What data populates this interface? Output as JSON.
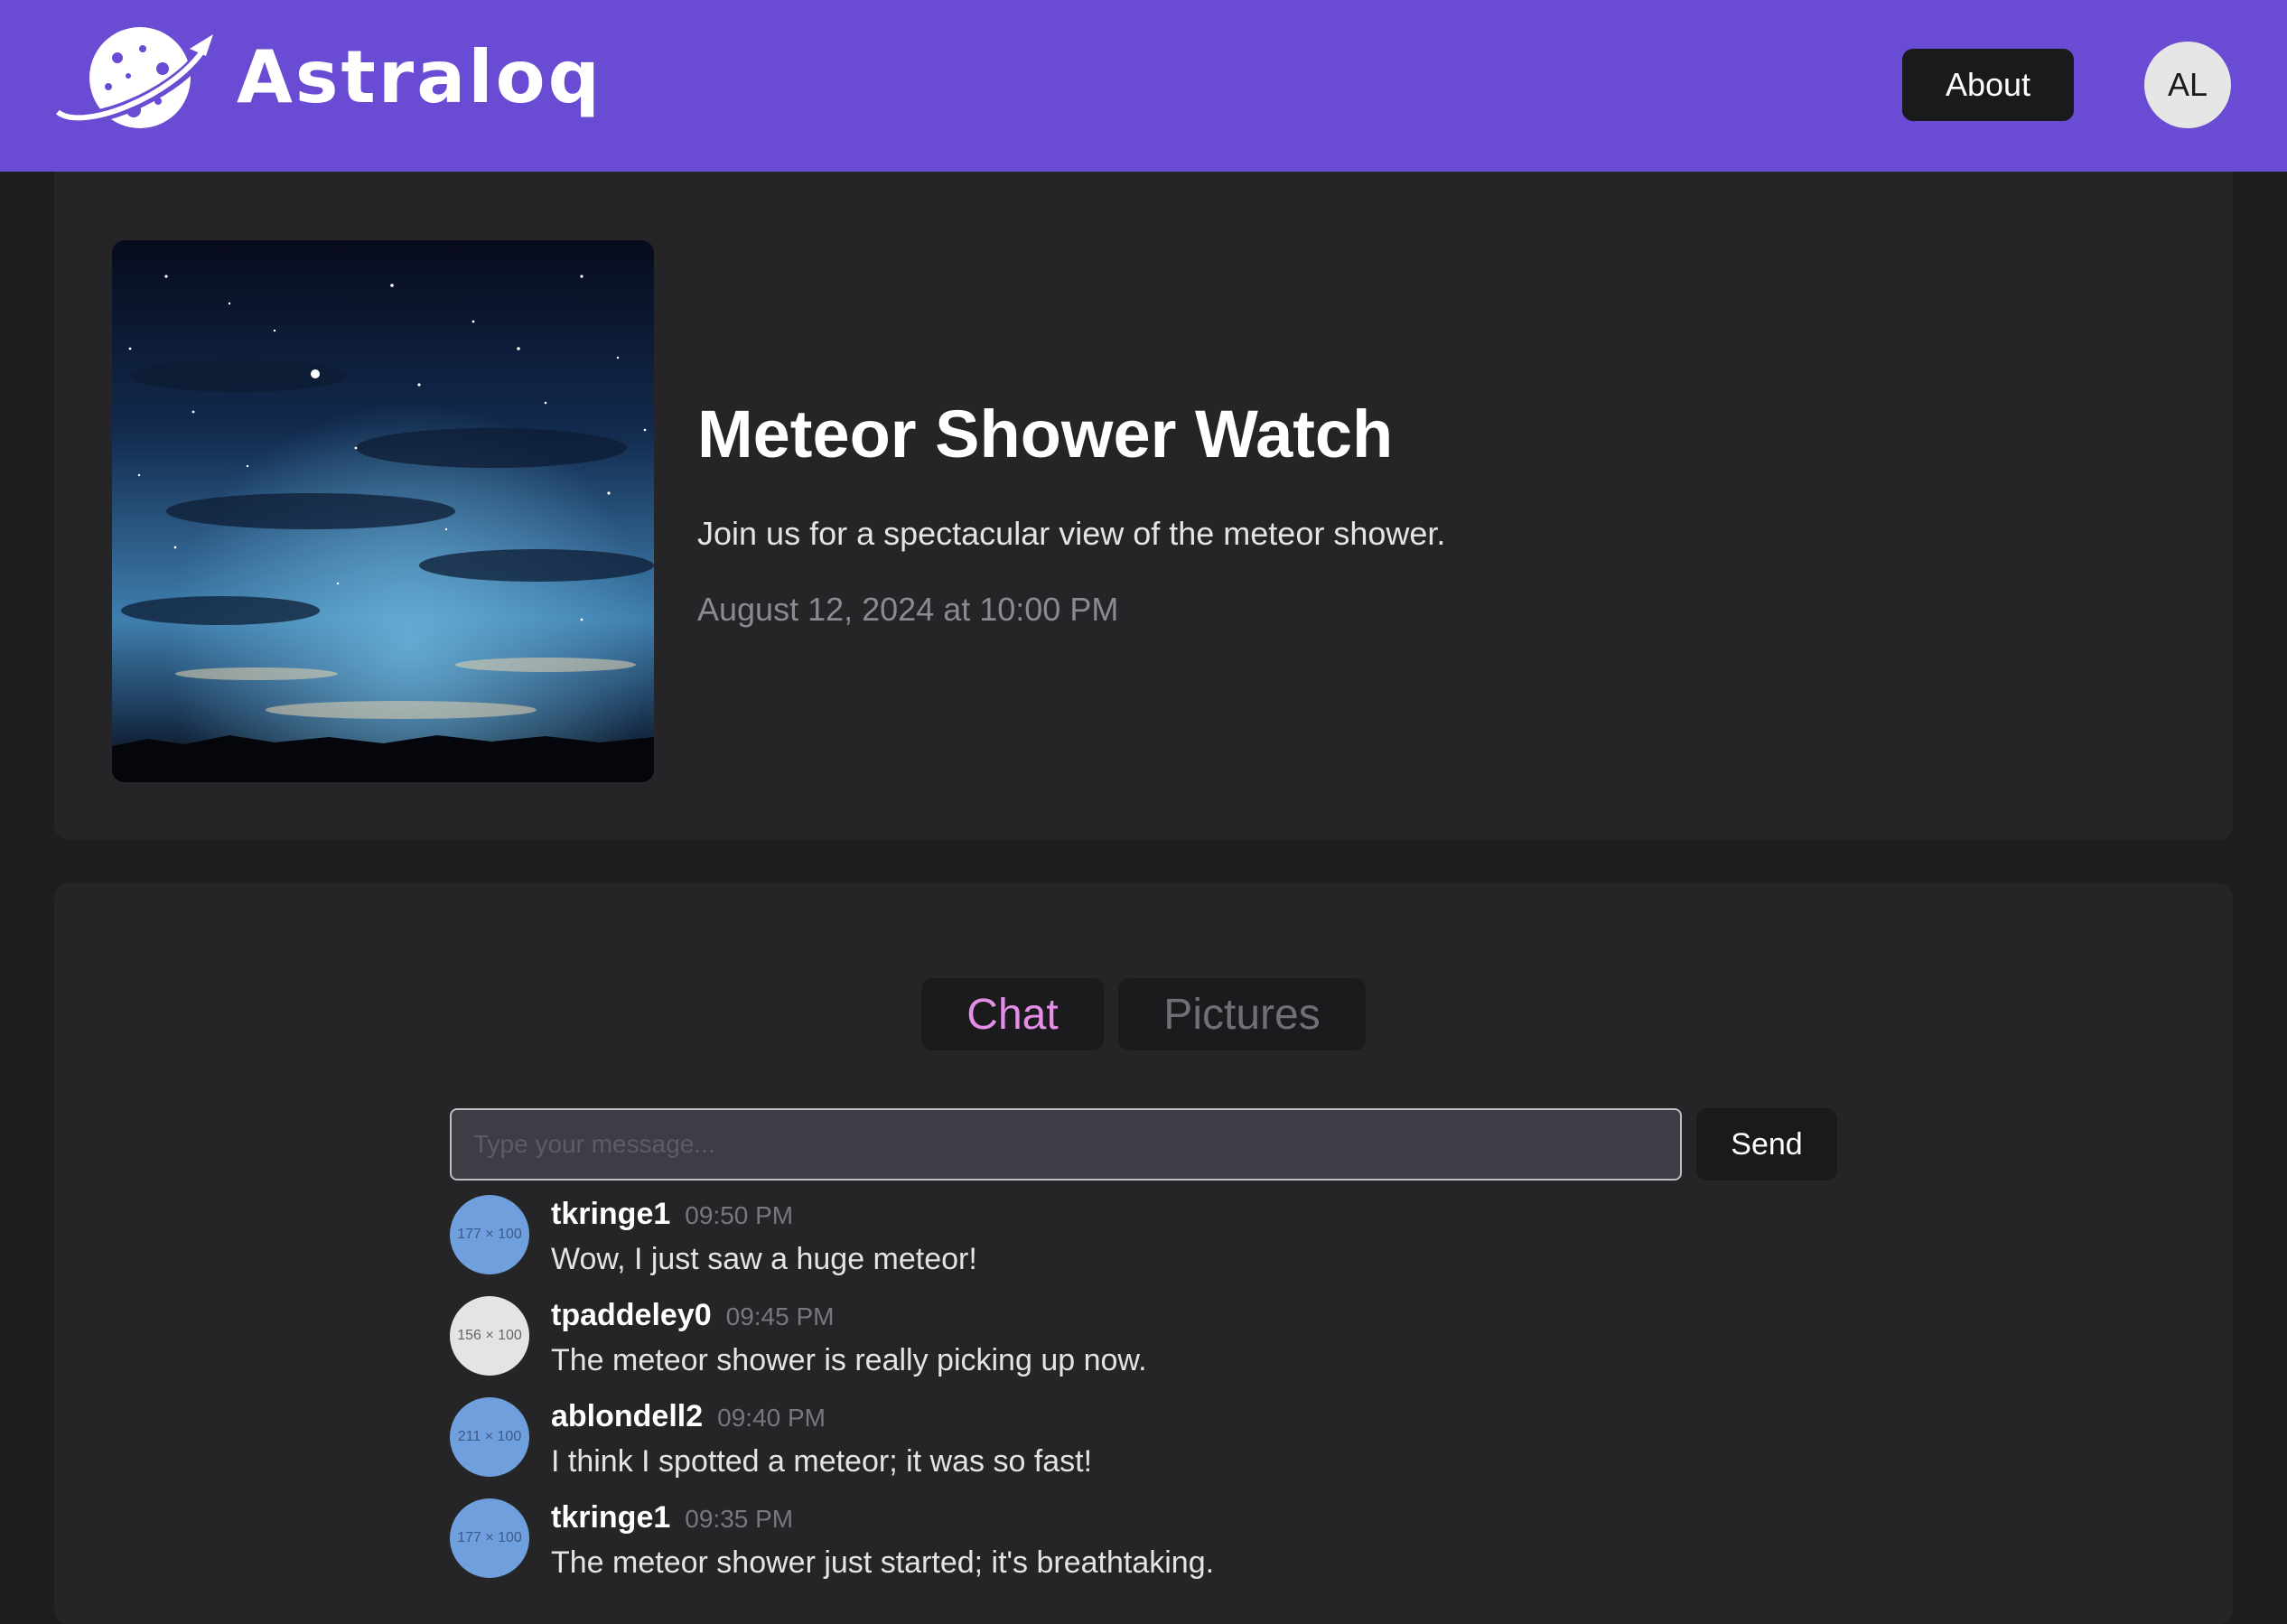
{
  "header": {
    "brand": "Astraloq",
    "about_label": "About",
    "avatar_initials": "AL"
  },
  "event": {
    "title": "Meteor Shower Watch",
    "description": "Join us for a spectacular view of the meteor shower.",
    "datetime": "August 12, 2024 at 10:00 PM"
  },
  "tabs": [
    {
      "label": "Chat",
      "active": true
    },
    {
      "label": "Pictures",
      "active": false
    }
  ],
  "chat": {
    "placeholder": "Type your message...",
    "send_label": "Send",
    "messages": [
      {
        "user": "tkringe1",
        "time": "09:50 PM",
        "text": "Wow, I just saw a huge meteor!",
        "avatar_label": "177 × 100",
        "avatar_color": "#6f9fdc"
      },
      {
        "user": "tpaddeley0",
        "time": "09:45 PM",
        "text": "The meteor shower is really picking up now.",
        "avatar_label": "156 × 100",
        "avatar_color": "#e4e4e4"
      },
      {
        "user": "ablondell2",
        "time": "09:40 PM",
        "text": "I think I spotted a meteor; it was so fast!",
        "avatar_label": "211 × 100",
        "avatar_color": "#6f9fdc"
      },
      {
        "user": "tkringe1",
        "time": "09:35 PM",
        "text": "The meteor shower just started; it's breathtaking.",
        "avatar_label": "177 × 100",
        "avatar_color": "#6f9fdc"
      }
    ]
  },
  "colors": {
    "header_bg": "#6a4bd3",
    "page_bg": "#1e1e20",
    "card_bg": "#252527",
    "active_tab_text": "#e58ee6"
  }
}
